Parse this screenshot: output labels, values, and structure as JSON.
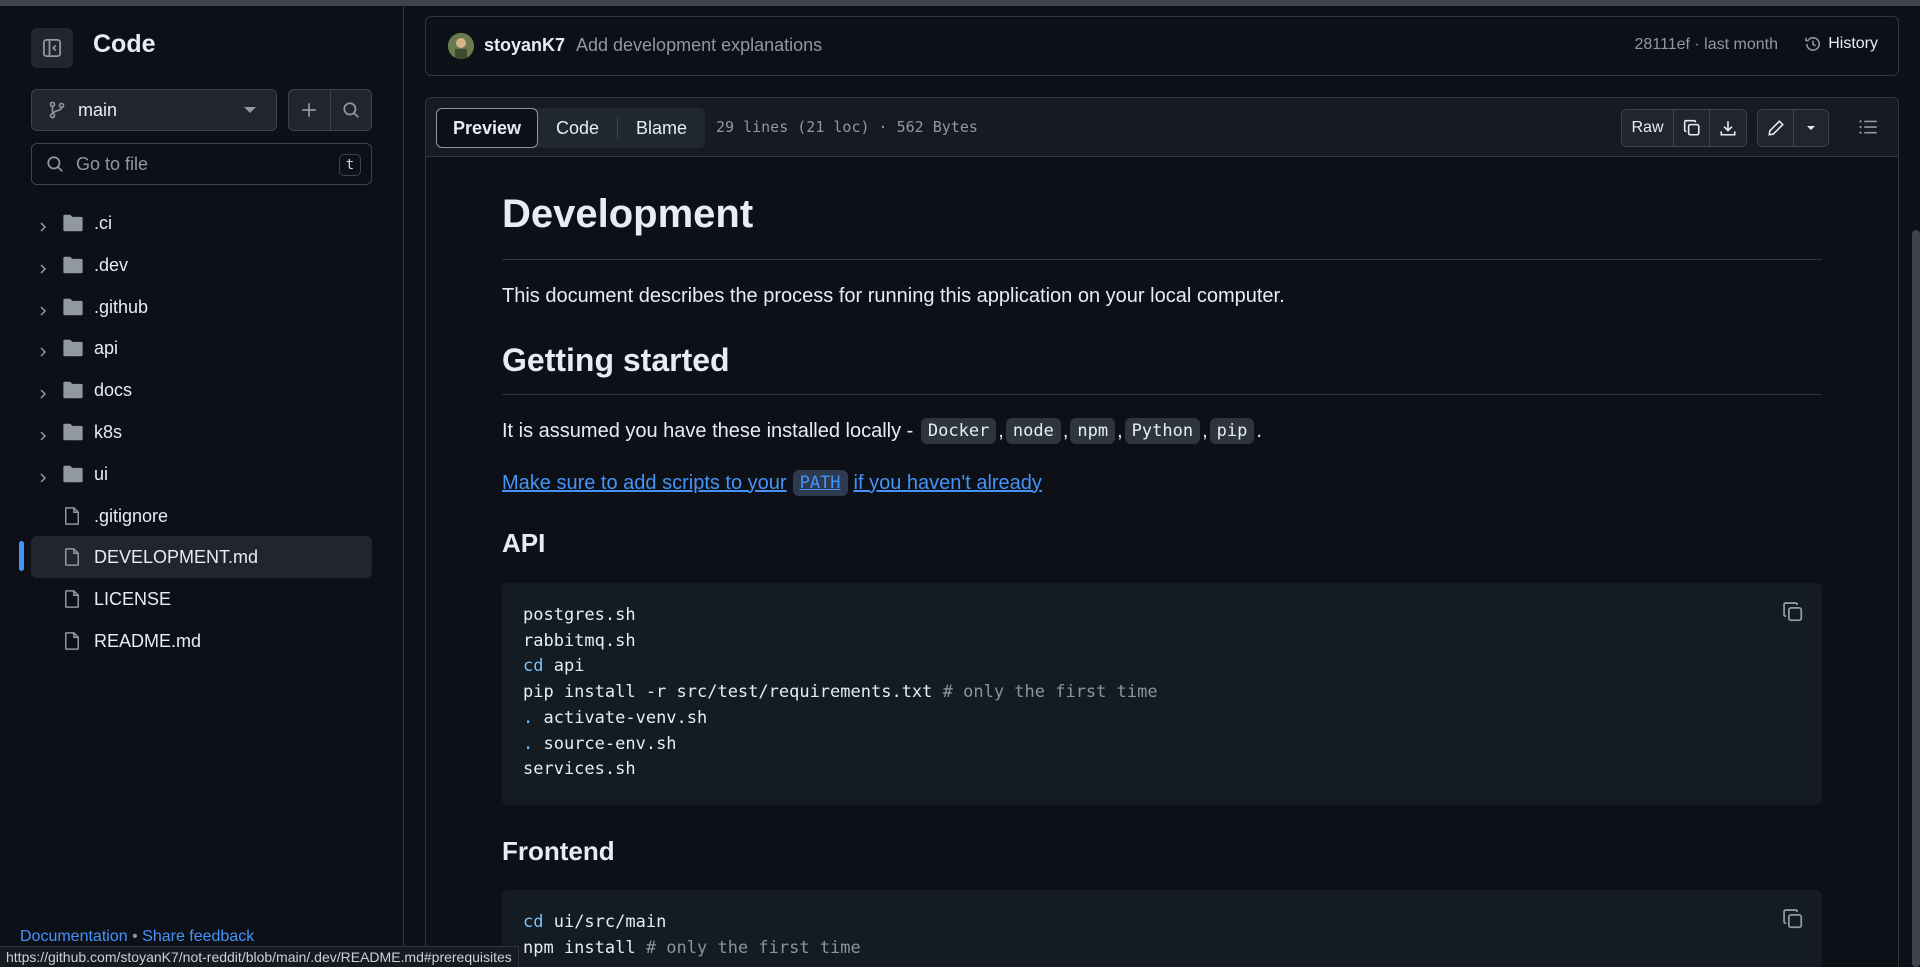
{
  "sidebar": {
    "title": "Code",
    "branch": "main",
    "goto_placeholder": "Go to file",
    "goto_shortcut": "t",
    "items": [
      {
        "label": ".ci",
        "type": "folder"
      },
      {
        "label": ".dev",
        "type": "folder"
      },
      {
        "label": ".github",
        "type": "folder"
      },
      {
        "label": "api",
        "type": "folder"
      },
      {
        "label": "docs",
        "type": "folder"
      },
      {
        "label": "k8s",
        "type": "folder"
      },
      {
        "label": "ui",
        "type": "folder"
      },
      {
        "label": ".gitignore",
        "type": "file"
      },
      {
        "label": "DEVELOPMENT.md",
        "type": "file",
        "active": true
      },
      {
        "label": "LICENSE",
        "type": "file"
      },
      {
        "label": "README.md",
        "type": "file"
      }
    ],
    "footer": {
      "docs": "Documentation",
      "sep": "•",
      "feedback": "Share feedback"
    }
  },
  "statusbar": "https://github.com/stoyanK7/not-reddit/blob/main/.dev/README.md#prerequisites",
  "commit": {
    "author": "stoyanK7",
    "message": "Add development explanations",
    "meta": "28111ef · last month",
    "history": "History"
  },
  "file": {
    "tabs": [
      "Preview",
      "Code",
      "Blame"
    ],
    "info": "29 lines (21 loc) · 562 Bytes",
    "raw": "Raw"
  },
  "markdown": {
    "h1": "Development",
    "p1": "This document describes the process for running this application on your local computer.",
    "h2": "Getting started",
    "p2_prefix": "It is assumed you have these installed locally - ",
    "p2_tools": [
      "Docker",
      "node",
      "npm",
      "Python",
      "pip"
    ],
    "p2_suffix": ".",
    "link_before": "Make sure to add scripts to your",
    "link_code": "PATH",
    "link_after": "if you haven't already",
    "h3_api": "API",
    "h3_frontend": "Frontend",
    "code_api": [
      "postgres.sh",
      "rabbitmq.sh",
      "cd api",
      "pip install -r src/test/requirements.txt # only the first time",
      ". activate-venv.sh",
      ". source-env.sh",
      "services.sh"
    ],
    "code_frontend": [
      "cd ui/src/main",
      "npm install # only the first time"
    ]
  },
  "colors": {
    "accent": "#4493f8",
    "bg": "#0d1117",
    "border": "#30363d"
  }
}
